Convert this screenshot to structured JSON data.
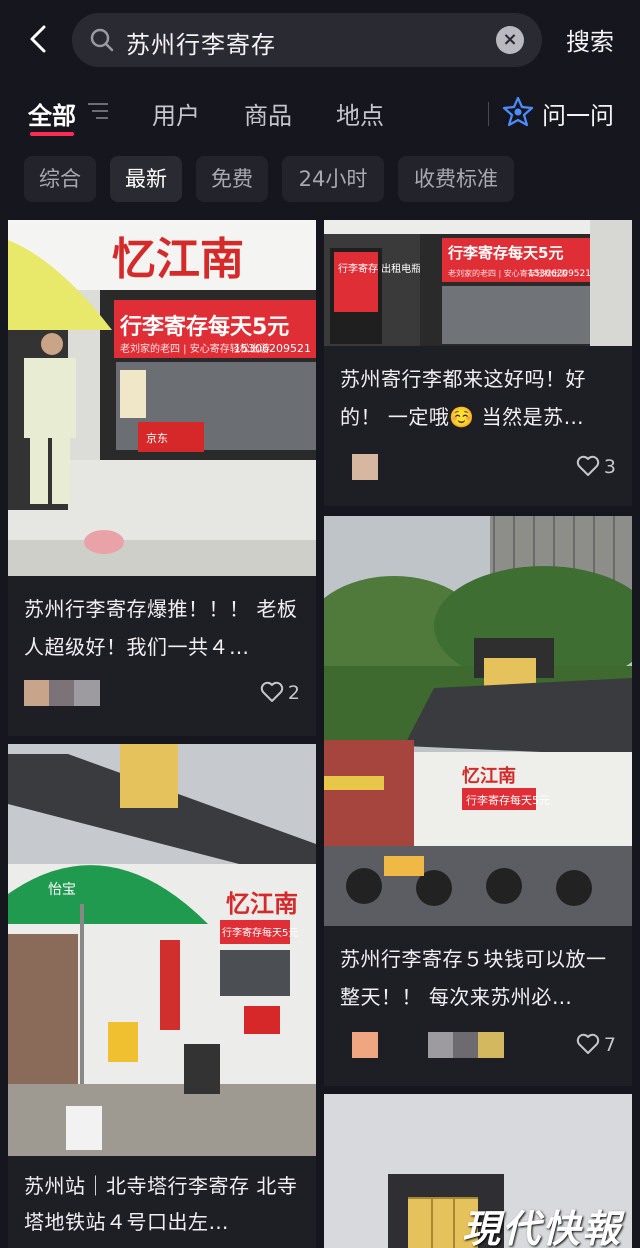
{
  "search": {
    "query": "苏州行李寄存",
    "button_label": "搜索"
  },
  "tabs": [
    {
      "label": "全部",
      "active": true
    },
    {
      "label": "用户"
    },
    {
      "label": "商品"
    },
    {
      "label": "地点"
    },
    {
      "label": "问一问"
    }
  ],
  "filters": [
    {
      "label": "综合"
    },
    {
      "label": "最新",
      "active": true
    },
    {
      "label": "免费"
    },
    {
      "label": "24小时"
    },
    {
      "label": "收费标准"
    }
  ],
  "cards": [
    {
      "title": "苏州行李寄存爆推！！！ 老板人超级好！我们一共４…",
      "likes": "2",
      "sign_name": "忆江南",
      "sign_banner": "行李寄存每天5元",
      "sign_phone": "15306209521",
      "sign_sub": "老刘家的老四 | 安心寄存轻松出游",
      "box_label": "京东"
    },
    {
      "title": "苏州寄行李都来这好吗！好的！ 一定哦☺️ 当然是苏…",
      "likes": "3",
      "sign_banner": "行李寄存每天5元",
      "sign_phone": "15306209521",
      "sign_sub": "老刘家的老四 | 安心寄存轻松出游",
      "sign_side": "行李寄存 出租电瓶车"
    },
    {
      "title": "苏州行李寄存５块钱可以放一整天！！ 每次来苏州必…",
      "likes": "7",
      "sign_name": "忆江南",
      "sign_banner": "行李寄存每天5元"
    },
    {
      "title": "苏州站｜北寺塔行李寄存 北寺塔地铁站４号口出左…",
      "sign_name": "忆江南",
      "sign_banner": "行李寄存每天5元",
      "umbrella_text": "怡宝"
    },
    {
      "title": ""
    }
  ],
  "watermark": "現代快報",
  "colors": {
    "accent": "#fe2c55",
    "background": "#16161e",
    "card": "#1e1e25"
  },
  "icons": [
    "back-arrow-icon",
    "search-icon",
    "clear-icon",
    "filter-icon",
    "ask-star-icon",
    "heart-icon"
  ]
}
